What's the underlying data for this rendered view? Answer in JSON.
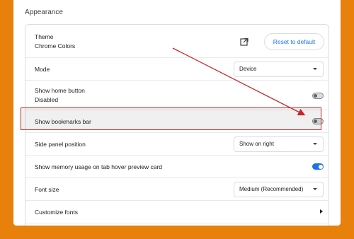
{
  "section": {
    "title": "Appearance"
  },
  "theme": {
    "label": "Theme",
    "value": "Chrome Colors",
    "open_icon": "open-in-new-icon",
    "reset_label": "Reset to default"
  },
  "mode": {
    "label": "Mode",
    "selected": "Device"
  },
  "home_button": {
    "label": "Show home button",
    "value": "Disabled",
    "enabled": false
  },
  "bookmarks_bar": {
    "label": "Show bookmarks bar",
    "enabled": false
  },
  "side_panel": {
    "label": "Side panel position",
    "selected": "Show on right"
  },
  "memory_usage": {
    "label": "Show memory usage on tab hover preview card",
    "enabled": true
  },
  "font_size": {
    "label": "Font size",
    "selected": "Medium (Recommended)"
  },
  "customize_fonts": {
    "label": "Customize fonts",
    "icon": "chevron-right-icon"
  },
  "colors": {
    "background": "#E8800C",
    "annotation": "#c62828",
    "accent": "#1a73e8"
  }
}
